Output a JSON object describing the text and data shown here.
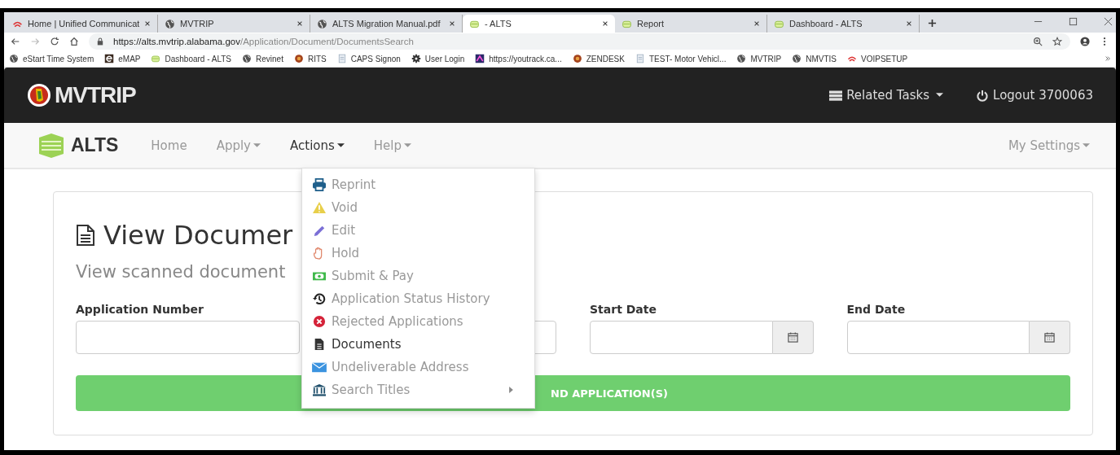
{
  "browser": {
    "tabs": [
      {
        "title": "Home | Unified Communicat",
        "kind": "phone",
        "selected": false
      },
      {
        "title": "MVTRIP",
        "kind": "globe",
        "selected": false
      },
      {
        "title": "ALTS Migration Manual.pdf",
        "kind": "globe",
        "selected": false
      },
      {
        "title": "- ALTS",
        "kind": "alts",
        "selected": true
      },
      {
        "title": "Report",
        "kind": "alts",
        "selected": false
      },
      {
        "title": "Dashboard - ALTS",
        "kind": "alts",
        "selected": false
      }
    ],
    "url_host": "https://alts.mvtrip.alabama.gov",
    "url_path": "/Application/Document/DocumentsSearch",
    "bookmarks": [
      {
        "label": "eStart Time System",
        "kind": "globe"
      },
      {
        "label": "eMAP",
        "kind": "e"
      },
      {
        "label": "Dashboard - ALTS",
        "kind": "alts"
      },
      {
        "label": "Revinet",
        "kind": "globe"
      },
      {
        "label": "RITS",
        "kind": "ball"
      },
      {
        "label": "CAPS Signon",
        "kind": "doc"
      },
      {
        "label": "User Login",
        "kind": "gear"
      },
      {
        "label": "https://youtrack.ca...",
        "kind": "yt"
      },
      {
        "label": "ZENDESK",
        "kind": "ball"
      },
      {
        "label": "TEST- Motor Vehicl...",
        "kind": "doc"
      },
      {
        "label": "MVTRIP",
        "kind": "globe"
      },
      {
        "label": "NMVTIS",
        "kind": "globe"
      },
      {
        "label": "VOIPSETUP",
        "kind": "phone"
      }
    ]
  },
  "header": {
    "brand": "MVTRIP",
    "related_tasks": "Related Tasks",
    "logout": "Logout 3700063"
  },
  "nav": {
    "brand": "ALTS",
    "items": [
      {
        "label": "Home",
        "dropdown": false,
        "selected": false
      },
      {
        "label": "Apply",
        "dropdown": true,
        "selected": false
      },
      {
        "label": "Actions",
        "dropdown": true,
        "selected": true
      },
      {
        "label": "Help",
        "dropdown": true,
        "selected": false
      }
    ],
    "settings": "My Settings"
  },
  "actions_menu": [
    {
      "label": "Reprint",
      "kind": "printer",
      "selected": false,
      "submenu": false
    },
    {
      "label": "Void",
      "kind": "warning",
      "selected": false,
      "submenu": false
    },
    {
      "label": "Edit",
      "kind": "pencil",
      "selected": false,
      "submenu": false
    },
    {
      "label": "Hold",
      "kind": "hand",
      "selected": false,
      "submenu": false
    },
    {
      "label": "Submit & Pay",
      "kind": "money",
      "selected": false,
      "submenu": false
    },
    {
      "label": "Application Status History",
      "kind": "history",
      "selected": false,
      "submenu": false
    },
    {
      "label": "Rejected Applications",
      "kind": "error",
      "selected": false,
      "submenu": false
    },
    {
      "label": "Documents",
      "kind": "document",
      "selected": true,
      "submenu": false
    },
    {
      "label": "Undeliverable Address",
      "kind": "envelope",
      "selected": false,
      "submenu": false
    },
    {
      "label": "Search Titles",
      "kind": "bank",
      "selected": false,
      "submenu": true
    }
  ],
  "page": {
    "title": "View Documer",
    "subtitle": "View scanned document",
    "fields": [
      {
        "label": "Application Number",
        "kind": "text"
      },
      {
        "kind": "text"
      },
      {
        "label": "Start Date",
        "kind": "date"
      },
      {
        "label": "End Date",
        "kind": "date"
      }
    ],
    "find_button": "ND APPLICATION(S)"
  }
}
